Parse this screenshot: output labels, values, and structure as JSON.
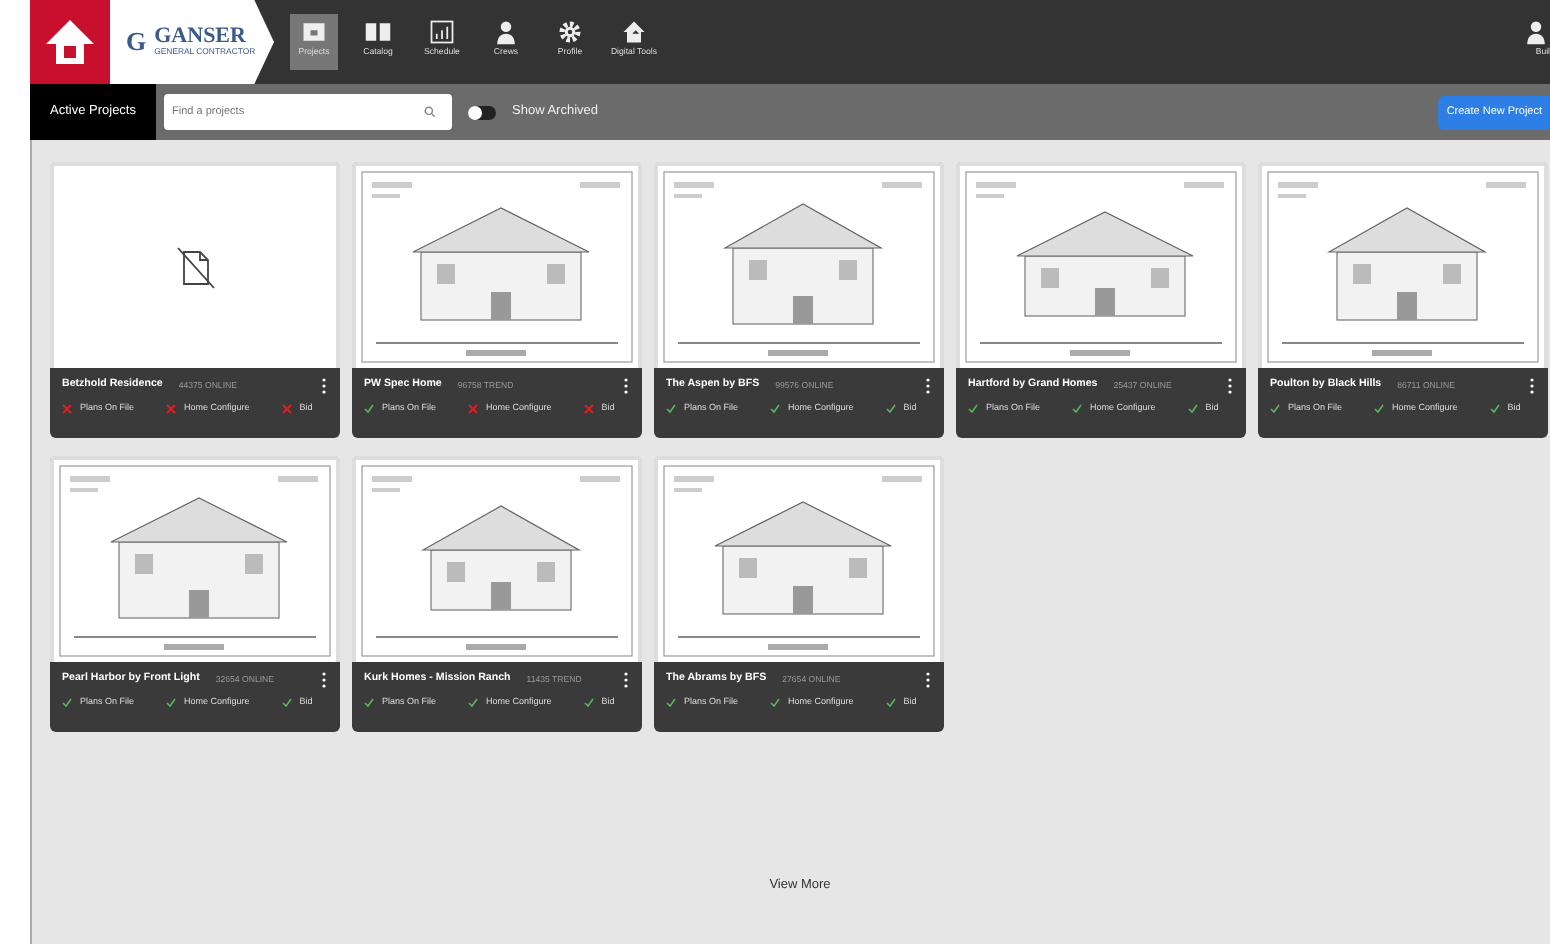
{
  "header": {
    "logo_initial": "G",
    "logo_name": "GANSER",
    "logo_tagline": "GENERAL CONTRACTOR",
    "nav": [
      {
        "label": "Projects",
        "selected": true
      },
      {
        "label": "Catalog",
        "selected": false
      },
      {
        "label": "Schedule",
        "selected": false
      },
      {
        "label": "Crews",
        "selected": false
      },
      {
        "label": "Profile",
        "selected": false
      },
      {
        "label": "Digital Tools",
        "selected": false
      }
    ],
    "nav_right": {
      "label": "Buil"
    }
  },
  "toolbar": {
    "active_tab": "Active Projects",
    "search": {
      "placeholder": "Find a projects"
    },
    "archived_toggle": {
      "label": "Show Archived",
      "on": false
    },
    "create_button": "Create New Project"
  },
  "projects": [
    {
      "name": "Betzhold Residence",
      "code": "44375 ONLINE",
      "kind": "missing-image",
      "statuses": [
        {
          "label": "Plans On File",
          "ok": false
        },
        {
          "label": "Home Configure",
          "ok": false
        },
        {
          "label": "Bid",
          "ok": false
        }
      ]
    },
    {
      "name": "PW Spec Home",
      "code": "96758 TREND",
      "kind": "picture",
      "statuses": [
        {
          "label": "Plans On File",
          "ok": true
        },
        {
          "label": "Home Configure",
          "ok": false
        },
        {
          "label": "Bid",
          "ok": false
        }
      ]
    },
    {
      "name": "The Aspen by BFS",
      "code": "99576 ONLINE",
      "kind": "picture",
      "statuses": [
        {
          "label": "Plans On File",
          "ok": true
        },
        {
          "label": "Home Configure",
          "ok": true
        },
        {
          "label": "Bid",
          "ok": true
        }
      ]
    },
    {
      "name": "Hartford by Grand Homes",
      "code": "25437 ONLINE",
      "kind": "picture",
      "statuses": [
        {
          "label": "Plans On File",
          "ok": true
        },
        {
          "label": "Home Configure",
          "ok": true
        },
        {
          "label": "Bid",
          "ok": true
        }
      ]
    },
    {
      "name": "Poulton by Black Hills",
      "code": "86711 ONLINE",
      "kind": "picture",
      "statuses": [
        {
          "label": "Plans On File",
          "ok": true
        },
        {
          "label": "Home Configure",
          "ok": true
        },
        {
          "label": "Bid",
          "ok": true
        }
      ]
    },
    {
      "name": "Pearl Harbor by Front Light",
      "code": "32654 ONLINE",
      "kind": "picture",
      "statuses": [
        {
          "label": "Plans On File",
          "ok": true
        },
        {
          "label": "Home Configure",
          "ok": true
        },
        {
          "label": "Bid",
          "ok": true
        }
      ]
    },
    {
      "name": "Kurk Homes - Mission Ranch",
      "code": "11435 TREND",
      "kind": "picture",
      "statuses": [
        {
          "label": "Plans On File",
          "ok": true
        },
        {
          "label": "Home Configure",
          "ok": true
        },
        {
          "label": "Bid",
          "ok": true
        }
      ]
    },
    {
      "name": "The Abrams by BFS",
      "code": "27654 ONLINE",
      "kind": "picture",
      "statuses": [
        {
          "label": "Plans On File",
          "ok": true
        },
        {
          "label": "Home Configure",
          "ok": true
        },
        {
          "label": "Bid",
          "ok": true
        }
      ]
    }
  ],
  "view_more": "View More"
}
